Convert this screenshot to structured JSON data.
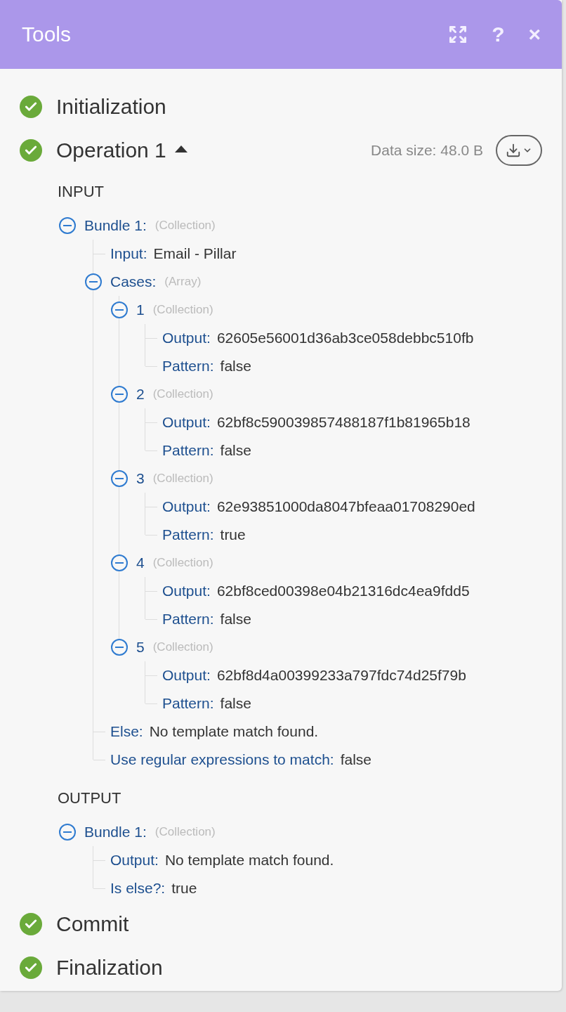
{
  "header": {
    "title": "Tools",
    "help_label": "?",
    "close_label": "×"
  },
  "steps": [
    {
      "label": "Initialization",
      "completed": true
    },
    {
      "label": "Operation 1",
      "completed": true,
      "expanded": true,
      "data_size": "Data size: 48.0 B",
      "sections": [
        {
          "title": "INPUT",
          "tree": [
            {
              "label": "Bundle 1:",
              "type": "(Collection)",
              "expanded": true,
              "children": [
                {
                  "label": "Input:",
                  "value": "Email - Pillar"
                },
                {
                  "label": "Cases:",
                  "type": "(Array)",
                  "expanded": true,
                  "children": [
                    {
                      "label": "1",
                      "type": "(Collection)",
                      "expanded": true,
                      "children": [
                        {
                          "label": "Output:",
                          "value": "62605e56001d36ab3ce058debbc510fb"
                        },
                        {
                          "label": "Pattern:",
                          "value": "false"
                        }
                      ]
                    },
                    {
                      "label": "2",
                      "type": "(Collection)",
                      "expanded": true,
                      "children": [
                        {
                          "label": "Output:",
                          "value": "62bf8c590039857488187f1b81965b18"
                        },
                        {
                          "label": "Pattern:",
                          "value": "false"
                        }
                      ]
                    },
                    {
                      "label": "3",
                      "type": "(Collection)",
                      "expanded": true,
                      "children": [
                        {
                          "label": "Output:",
                          "value": "62e93851000da8047bfeaa01708290ed"
                        },
                        {
                          "label": "Pattern:",
                          "value": "true"
                        }
                      ]
                    },
                    {
                      "label": "4",
                      "type": "(Collection)",
                      "expanded": true,
                      "children": [
                        {
                          "label": "Output:",
                          "value": "62bf8ced00398e04b21316dc4ea9fdd5"
                        },
                        {
                          "label": "Pattern:",
                          "value": "false"
                        }
                      ]
                    },
                    {
                      "label": "5",
                      "type": "(Collection)",
                      "expanded": true,
                      "children": [
                        {
                          "label": "Output:",
                          "value": "62bf8d4a00399233a797fdc74d25f79b"
                        },
                        {
                          "label": "Pattern:",
                          "value": "false"
                        }
                      ]
                    }
                  ]
                },
                {
                  "label": "Else:",
                  "value": "No template match found."
                },
                {
                  "label": "Use regular expressions to match:",
                  "value": "false"
                }
              ]
            }
          ]
        },
        {
          "title": "OUTPUT",
          "tree": [
            {
              "label": "Bundle 1:",
              "type": "(Collection)",
              "expanded": true,
              "children": [
                {
                  "label": "Output:",
                  "value": "No template match found."
                },
                {
                  "label": "Is else?:",
                  "value": "true"
                }
              ]
            }
          ]
        }
      ]
    },
    {
      "label": "Commit",
      "completed": true
    },
    {
      "label": "Finalization",
      "completed": true
    }
  ]
}
